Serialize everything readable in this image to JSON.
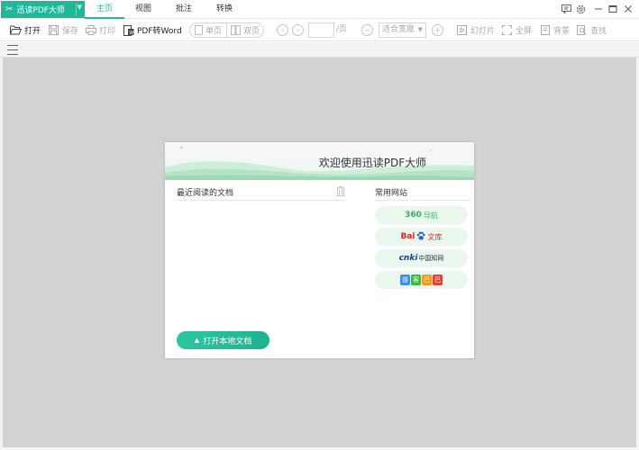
{
  "app": {
    "name": "迅读PDF大师"
  },
  "menu_tabs": [
    {
      "label": "主页",
      "active": true
    },
    {
      "label": "视图",
      "active": false
    },
    {
      "label": "批注",
      "active": false
    },
    {
      "label": "转换",
      "active": false
    }
  ],
  "toolbar": {
    "open": "打开",
    "save": "保存",
    "print": "打印",
    "pdf_to_word": "PDF转Word",
    "single_page": "单页",
    "double_page": "双页",
    "page_value": "",
    "page_suffix": "/页",
    "zoom": "适合宽度",
    "slideshow": "幻灯片",
    "fullscreen": "全屏",
    "background": "背景",
    "find": "查找"
  },
  "welcome": {
    "title": "欢迎使用迅读PDF大师",
    "recent_label": "最近阅读的文档",
    "sites_label": "常用网站",
    "open_button": "打开本地文档",
    "sites": {
      "s360_main": "360",
      "s360_sub": "导航",
      "baidu_main": "Bai",
      "baidu_sub": "文库",
      "cnki_main": "cnki",
      "cnki_sub": "中国知网",
      "daoke": [
        "道",
        "客",
        "巴",
        "巴"
      ]
    }
  },
  "colors": {
    "accent": "#1fb89a",
    "workspace": "#d2d2d2"
  }
}
